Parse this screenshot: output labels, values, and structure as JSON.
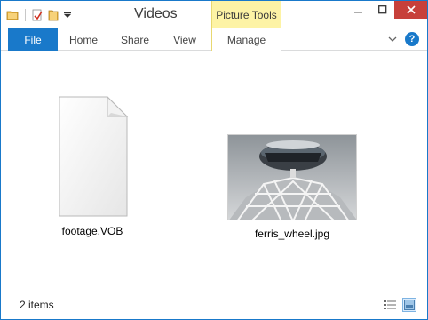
{
  "window": {
    "title": "Videos"
  },
  "contextual": {
    "group_label": "Picture Tools"
  },
  "ribbon": {
    "tabs": [
      {
        "label": "File"
      },
      {
        "label": "Home"
      },
      {
        "label": "Share"
      },
      {
        "label": "View"
      },
      {
        "label": "Manage"
      }
    ],
    "help_label": "?"
  },
  "files": [
    {
      "name": "footage.VOB",
      "icon": "blank-document-icon"
    },
    {
      "name": "ferris_wheel.jpg",
      "icon": "image-thumbnail"
    }
  ],
  "status": {
    "item_count": "2 items"
  },
  "colors": {
    "accent": "#1979ca",
    "contextual": "#fdf3a5",
    "close": "#c7403a"
  }
}
